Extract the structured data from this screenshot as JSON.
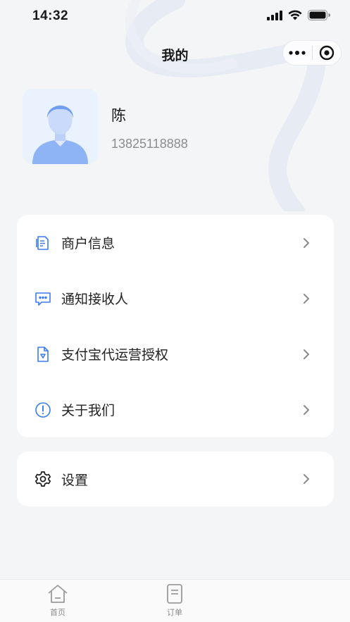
{
  "status_bar": {
    "time": "14:32"
  },
  "nav": {
    "title": "我的"
  },
  "profile": {
    "name": "陈",
    "phone": "13825118888"
  },
  "menu": {
    "items": [
      {
        "label": "商户信息",
        "icon": "merchant-doc-icon"
      },
      {
        "label": "通知接收人",
        "icon": "message-icon"
      },
      {
        "label": "支付宝代运营授权",
        "icon": "shield-doc-icon"
      },
      {
        "label": "关于我们",
        "icon": "info-icon"
      }
    ]
  },
  "settings": {
    "label": "设置",
    "icon": "gear-icon"
  },
  "tab_bar": {
    "tabs": [
      {
        "label": "首页",
        "icon": "home-icon"
      },
      {
        "label": "订单",
        "icon": "order-icon"
      }
    ]
  },
  "colors": {
    "accent": "#3b7cf0",
    "background": "#f4f5f7",
    "card": "#ffffff"
  }
}
